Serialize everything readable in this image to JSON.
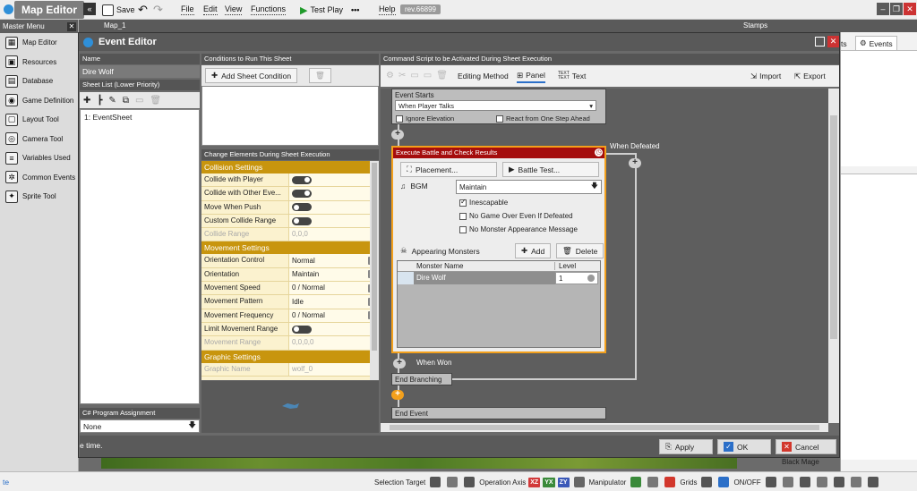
{
  "topbar": {
    "app_title": "Map Editor",
    "save": "Save",
    "menus": [
      "File",
      "Edit",
      "View",
      "Functions"
    ],
    "test_play": "Test Play",
    "help": "Help",
    "revision": "rev.66899"
  },
  "master_menu": {
    "title": "Master Menu",
    "items": [
      "Map Editor",
      "Resources",
      "Database",
      "Game Definition",
      "Layout Tool",
      "Camera Tool",
      "Variables Used",
      "Common Events",
      "Sprite Tool"
    ]
  },
  "back_window": {
    "map_tab": "Map_1",
    "stamps_tab": "Stamps"
  },
  "right_panel": {
    "tab_partial": "ts",
    "events_tab": "Events",
    "black_mage": "Black Mage"
  },
  "dialog": {
    "title": "Event Editor",
    "name_header": "Name",
    "name_value": "Dire Wolf",
    "sheet_list_header": "Sheet List (Lower Priority)",
    "sheets": [
      "1: EventSheet"
    ],
    "csharp_header": "C# Program Assignment",
    "csharp_value": "None",
    "conditions_header": "Conditions to Run This Sheet",
    "add_condition": "Add Sheet Condition",
    "change_header": "Change Elements During Sheet Execution",
    "props": [
      {
        "category": "Collision Settings",
        "rows": [
          {
            "name": "Collide with Player",
            "value": "",
            "kind": "toggle-on"
          },
          {
            "name": "Collide with Other Eve...",
            "value": "",
            "kind": "toggle-on"
          },
          {
            "name": "Move When Push",
            "value": "",
            "kind": "toggle-off"
          },
          {
            "name": "Custom Collide Range",
            "value": "",
            "kind": "toggle-off"
          },
          {
            "name": "Collide Range",
            "value": "0,0,0",
            "kind": "disabled"
          }
        ]
      },
      {
        "category": "Movement Settings",
        "rows": [
          {
            "name": "Orientation Control",
            "value": "Normal",
            "kind": "dropdown"
          },
          {
            "name": "Orientation",
            "value": "Maintain",
            "kind": "dropdown"
          },
          {
            "name": "Movement Speed",
            "value": "0 / Normal",
            "kind": "dropdown"
          },
          {
            "name": "Movement Pattern",
            "value": "Idle",
            "kind": "dropdown"
          },
          {
            "name": "Movement Frequency",
            "value": "0 / Normal",
            "kind": "dropdown"
          },
          {
            "name": "Limit Movement Range",
            "value": "",
            "kind": "toggle-off"
          },
          {
            "name": "Movement Range",
            "value": "0,0,0,0",
            "kind": "disabled"
          }
        ]
      },
      {
        "category": "Graphic Settings",
        "rows": [
          {
            "name": "Graphic Name",
            "value": "wolf_0",
            "kind": "disabled"
          }
        ]
      }
    ],
    "cmd_header": "Command Script to be Activated During Sheet Execution",
    "editing_method": "Editing Method",
    "panel_label": "Panel",
    "text_label": "Text",
    "import": "Import",
    "export": "Export",
    "event_starts": "Event Starts",
    "trigger": "When Player Talks",
    "ignore_elevation": "Ignore Elevation",
    "react_one_step": "React from One Step Ahead",
    "battle_node_title": "Execute Battle and Check Results",
    "placement": "Placement...",
    "battle_test": "Battle Test...",
    "bgm_label": "BGM",
    "bgm_value": "Maintain",
    "inescapable": "Inescapable",
    "no_game_over": "No Game Over Even If Defeated",
    "no_monster_msg": "No Monster Appearance Message",
    "appearing_monsters": "Appearing Monsters",
    "add": "Add",
    "delete": "Delete",
    "col_monster": "Monster Name",
    "col_level": "Level",
    "monsters": [
      {
        "name": "Dire Wolf",
        "level": "1"
      }
    ],
    "when_defeated": "When Defeated",
    "when_won": "When Won",
    "end_branching": "End Branching",
    "end_event": "End Event",
    "status_text": "e time.",
    "apply": "Apply",
    "ok": "OK",
    "cancel": "Cancel"
  },
  "statusbar": {
    "left": "te",
    "selection_target": "Selection Target",
    "operation_axis": "Operation Axis",
    "axes": [
      "XZ",
      "YX",
      "ZY"
    ],
    "manipulator": "Manipulator",
    "grids": "Grids",
    "onoff": "ON/OFF"
  },
  "colors": {
    "accent_gold": "#c8950e",
    "battle_header": "#a50d0d",
    "selected_orange": "#f3a01c",
    "cancel_red": "#d2372c",
    "ok_blue": "#2b6fc8"
  }
}
